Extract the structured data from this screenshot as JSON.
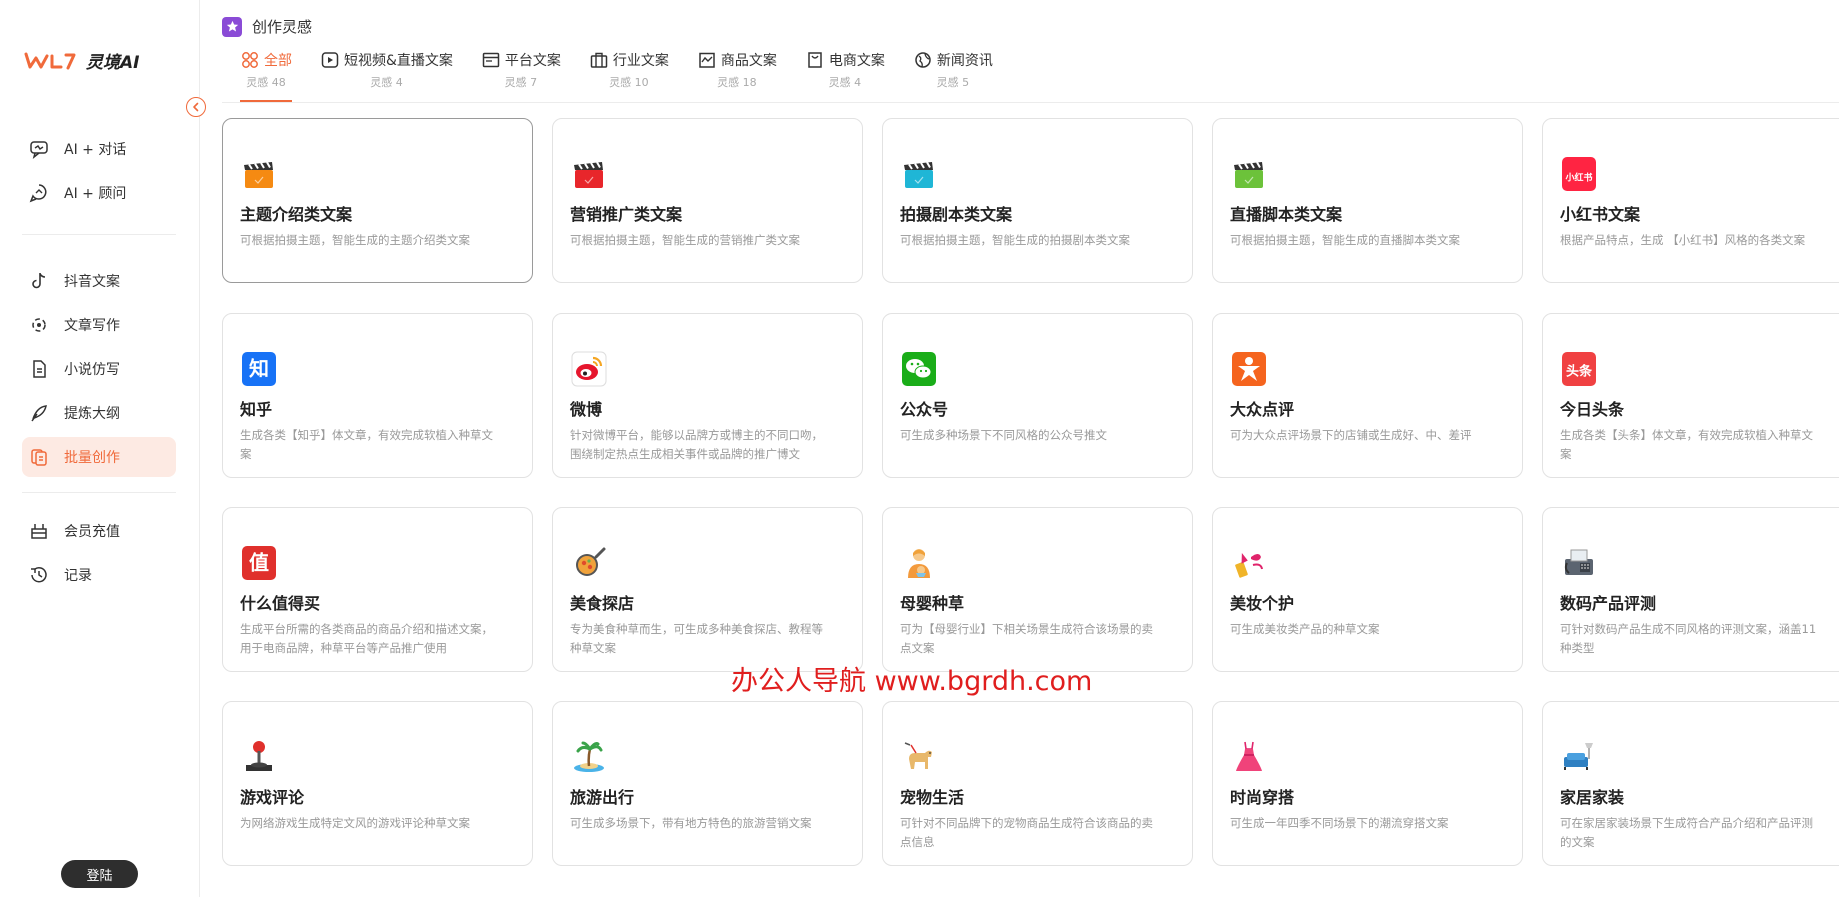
{
  "brand": {
    "name": "灵境AI"
  },
  "sidebar": {
    "groups": [
      [
        {
          "label": "AI + 对话",
          "icon": "chat-icon"
        },
        {
          "label": "AI + 顾问",
          "icon": "advisor-icon"
        }
      ],
      [
        {
          "label": "抖音文案",
          "icon": "douyin-icon"
        },
        {
          "label": "文章写作",
          "icon": "article-icon"
        },
        {
          "label": "小说仿写",
          "icon": "document-icon"
        },
        {
          "label": "提炼大纲",
          "icon": "pen-icon"
        },
        {
          "label": "批量创作",
          "icon": "batch-icon",
          "active": true
        }
      ],
      [
        {
          "label": "会员充值",
          "icon": "vip-icon"
        },
        {
          "label": "记录",
          "icon": "history-icon"
        }
      ]
    ],
    "login_label": "登陆"
  },
  "header": {
    "title": "创作灵感",
    "tabs": [
      {
        "label": "全部",
        "count": "灵感 48",
        "icon": "grid-icon",
        "active": true
      },
      {
        "label": "短视频&直播文案",
        "count": "灵感 4",
        "icon": "video-play-icon"
      },
      {
        "label": "平台文案",
        "count": "灵感 7",
        "icon": "browser-icon"
      },
      {
        "label": "行业文案",
        "count": "灵感 10",
        "icon": "briefcase-icon"
      },
      {
        "label": "商品文案",
        "count": "灵感 18",
        "icon": "store-icon"
      },
      {
        "label": "电商文案",
        "count": "灵感 4",
        "icon": "shopping-bag-icon"
      },
      {
        "label": "新闻资讯",
        "count": "灵感 5",
        "icon": "globe-icon"
      }
    ]
  },
  "cards": [
    {
      "title": "主题介绍类文案",
      "desc": "可根据拍摄主题，智能生成的主题介绍类文案",
      "icon": "clapper-orange-icon",
      "color": "#f58a12",
      "selected": true
    },
    {
      "title": "营销推广类文案",
      "desc": "可根据拍摄主题，智能生成的营销推广类文案",
      "icon": "clapper-red-icon",
      "color": "#e8262b"
    },
    {
      "title": "拍摄剧本类文案",
      "desc": "可根据拍摄主题，智能生成的拍摄剧本类文案",
      "icon": "clapper-cyan-icon",
      "color": "#1fb6d6"
    },
    {
      "title": "直播脚本类文案",
      "desc": "可根据拍摄主题，智能生成的直播脚本类文案",
      "icon": "clapper-green-icon",
      "color": "#6cc23a"
    },
    {
      "title": "小红书文案",
      "desc": "根据产品特点，生成 【小红书】风格的各类文案",
      "icon": "xiaohongshu-icon",
      "glyph": "小红书",
      "color": "#ff2442"
    },
    {
      "title": "知乎",
      "desc": "生成各类【知乎】体文章，有效完成软植入种草文案",
      "icon": "zhihu-icon",
      "glyph": "知",
      "color": "#1772f6"
    },
    {
      "title": "微博",
      "desc": "针对微博平台，能够以品牌方或博主的不同口吻，围绕制定热点生成相关事件或品牌的推广博文",
      "icon": "weibo-icon"
    },
    {
      "title": "公众号",
      "desc": "可生成多种场景下不同风格的公众号推文",
      "icon": "wechat-icon",
      "color": "#1aad19"
    },
    {
      "title": "大众点评",
      "desc": "可为大众点评场景下的店铺或生成好、中、差评",
      "icon": "dianping-icon",
      "color": "#f5641e"
    },
    {
      "title": "今日头条",
      "desc": "生成各类【头条】体文章，有效完成软植入种草文案",
      "icon": "toutiao-icon",
      "glyph": "头条",
      "color": "#f04142"
    },
    {
      "title": "什么值得买",
      "desc": "生成平台所需的各类商品的商品介绍和描述文案，用于电商品牌，种草平台等产品推广使用",
      "icon": "smzdm-icon",
      "glyph": "值",
      "color": "#e0302c"
    },
    {
      "title": "美食探店",
      "desc": "专为美食种草而生，可生成多种美食探店、教程等种草文案",
      "icon": "food-pan-icon"
    },
    {
      "title": "母婴种草",
      "desc": "可为【母婴行业】下相关场景生成符合该场景的卖点文案",
      "icon": "mother-baby-icon"
    },
    {
      "title": "美妆个护",
      "desc": "可生成美妆类产品的种草文案",
      "icon": "lipstick-icon"
    },
    {
      "title": "数码产品评测",
      "desc": "可针对数码产品生成不同风格的评测文案，涵盖11种类型",
      "icon": "fax-machine-icon"
    },
    {
      "title": "游戏评论",
      "desc": "为网络游戏生成特定文风的游戏评论种草文案",
      "icon": "joystick-icon"
    },
    {
      "title": "旅游出行",
      "desc": "可生成多场景下，带有地方特色的旅游营销文案",
      "icon": "island-icon"
    },
    {
      "title": "宠物生活",
      "desc": "可针对不同品牌下的宠物商品生成符合该商品的卖点信息",
      "icon": "guide-dog-icon"
    },
    {
      "title": "时尚穿搭",
      "desc": "可生成一年四季不同场景下的潮流穿搭文案",
      "icon": "dress-icon"
    },
    {
      "title": "家居家装",
      "desc": "可在家居家装场景下生成符合产品介绍和产品评测的文案",
      "icon": "sofa-lamp-icon"
    }
  ],
  "watermark": "办公人导航 www.bgrdh.com",
  "colors": {
    "accent": "#f06a3b",
    "active_bg": "#fdeae3",
    "header_star": "#8a4bd6"
  }
}
